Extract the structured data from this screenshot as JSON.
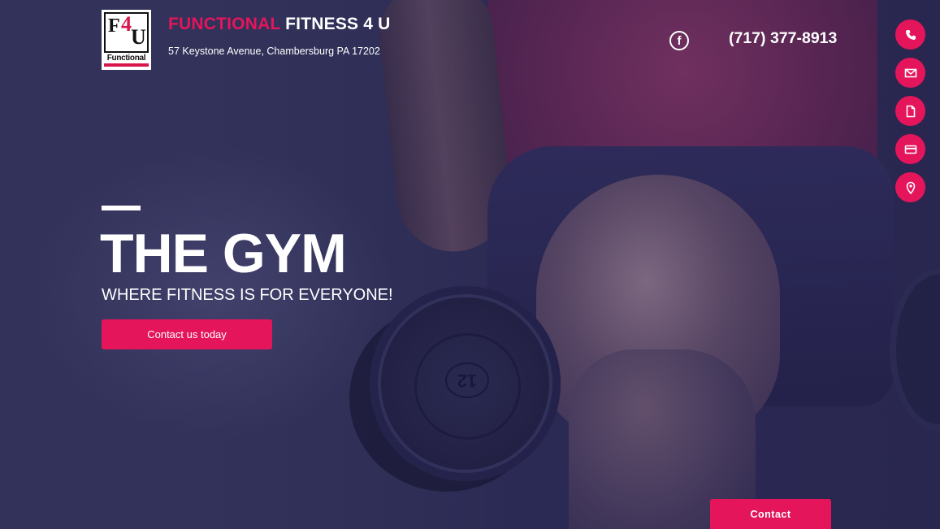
{
  "header": {
    "logo": {
      "letters": [
        "F",
        "4",
        "U"
      ],
      "word": "Functional"
    },
    "brand_primary": "FUNCTIONAL",
    "brand_secondary": "FITNESS 4 U",
    "address": "57 Keystone Avenue, Chambersburg PA 17202",
    "facebook_glyph": "f",
    "phone": "(717) 377-8913"
  },
  "side_actions": [
    {
      "icon": "phone-icon"
    },
    {
      "icon": "mail-icon"
    },
    {
      "icon": "document-icon"
    },
    {
      "icon": "credit-card-icon"
    },
    {
      "icon": "location-pin-icon"
    }
  ],
  "hero": {
    "title": "THE GYM",
    "subtitle": "WHERE FITNESS IS FOR EVERYONE!",
    "cta_label": "Contact us today",
    "dumbbell_number": "12"
  },
  "contact_tab": {
    "label": "Contact"
  },
  "colors": {
    "accent": "#e4155b",
    "text": "#ffffff",
    "background": "#2b2a4e"
  }
}
